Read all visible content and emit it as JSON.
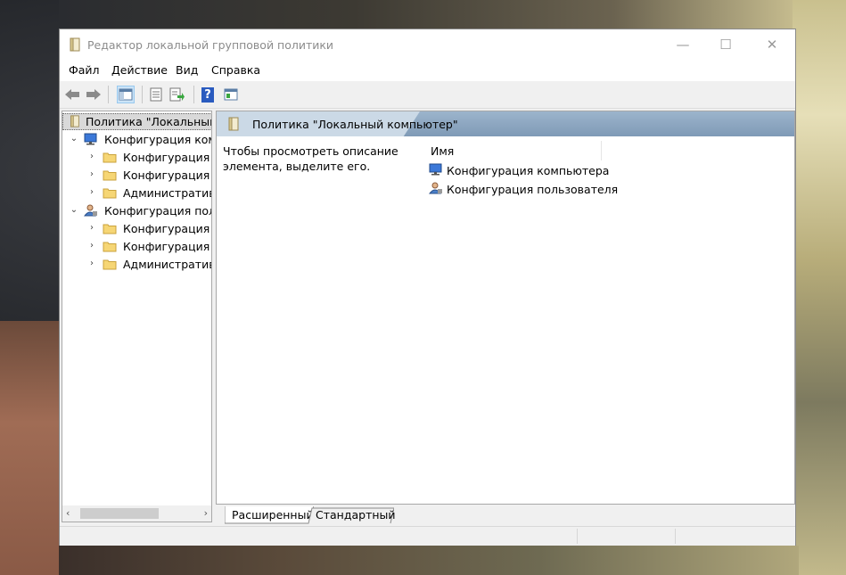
{
  "window": {
    "title": "Редактор локальной групповой политики",
    "minimize_glyph": "—",
    "maximize_glyph": "☐",
    "close_glyph": "✕"
  },
  "menu": {
    "file": "Файл",
    "action": "Действие",
    "view": "Вид",
    "help": "Справка"
  },
  "toolbar": {
    "icons": [
      "back-arrow-icon",
      "forward-arrow-icon",
      "show-hide-console-tree-icon",
      "properties-icon",
      "export-list-icon",
      "help-icon",
      "extended-view-icon"
    ],
    "help_glyph": "?"
  },
  "tree": {
    "root": "Политика \"Локальный к",
    "computer_config": "Конфигурация комп",
    "computer_children": [
      "Конфигурация п",
      "Конфигурация W",
      "Административн"
    ],
    "user_config": "Конфигурация поль",
    "user_children": [
      "Конфигурация п",
      "Конфигурация W",
      "Административн"
    ],
    "expanded_glyph": "⌄",
    "collapsed_glyph": "›",
    "scroll_left": "‹",
    "scroll_right": "›"
  },
  "details": {
    "header": "Политика \"Локальный компьютер\"",
    "description": "Чтобы просмотреть описание элемента, выделите его.",
    "column_name": "Имя",
    "items": [
      "Конфигурация компьютера",
      "Конфигурация пользователя"
    ]
  },
  "tabs": {
    "extended": "Расширенный",
    "standard": "Стандартный"
  },
  "colors": {
    "header_band": "#8fa8c2",
    "header_tab": "#cbd9e6",
    "folder": "#f6d675",
    "tree_selection": "#d9d9d9"
  }
}
